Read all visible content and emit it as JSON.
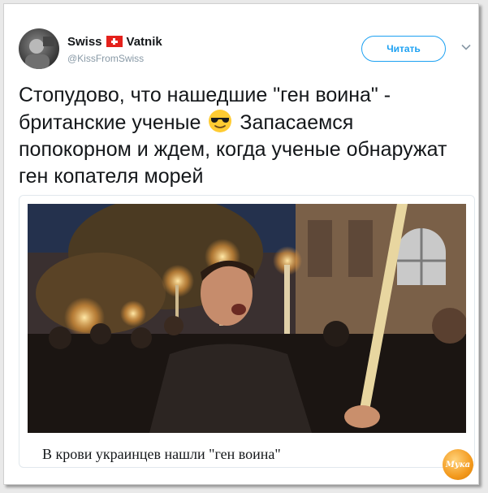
{
  "user": {
    "name_part1": "Swiss",
    "name_part2": "Vatnik",
    "handle": "@KissFromSwiss",
    "flag": "swiss-flag-icon"
  },
  "follow_button": {
    "label": "Читать"
  },
  "tweet": {
    "text_before_emoji": "Стопудово, что нашедшие \"ген воина\" - британские ученые",
    "emoji": "sunglasses-emoji",
    "text_after_emoji": "Запасаемся попокорном и ждем, когда ученые обнаружат ген копателя морей"
  },
  "card": {
    "title": "В крови украинцев нашли \"ген воина\""
  },
  "watermark": {
    "text": "Мука"
  },
  "colors": {
    "accent": "#1da1f2",
    "text": "#14171a",
    "muted": "#8899a6",
    "flag_red": "#e4211c"
  }
}
